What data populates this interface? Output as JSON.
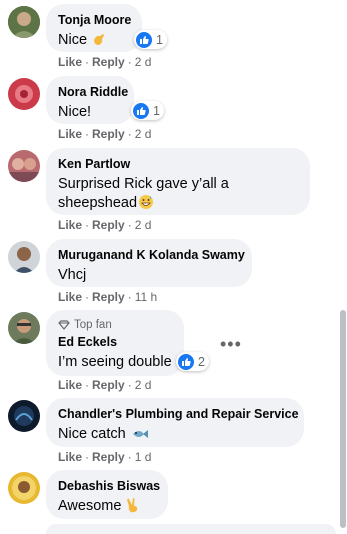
{
  "comments": [
    {
      "name": "Tonja Moore",
      "text": "Nice",
      "like": "Like",
      "reply": "Reply",
      "time": "2 d",
      "reaction_count": "1",
      "emoji": "hand-ok"
    },
    {
      "name": "Nora Riddle",
      "text": "Nice!",
      "like": "Like",
      "reply": "Reply",
      "time": "2 d",
      "reaction_count": "1"
    },
    {
      "name": "Ken Partlow",
      "text_line1": "Surprised Rick gave y’all a",
      "text_line2": "sheepshead",
      "like": "Like",
      "reply": "Reply",
      "time": "2 d",
      "emoji": "grinning-sweat"
    },
    {
      "name": "Muruganand K Kolanda Swamy",
      "text": "Vhcj",
      "like": "Like",
      "reply": "Reply",
      "time": "11 h"
    },
    {
      "name": "Ed Eckels",
      "badge": "Top fan",
      "text": "I’m seeing double",
      "like": "Like",
      "reply": "Reply",
      "time": "2 d",
      "reaction_count": "2"
    },
    {
      "name": "Chandler's Plumbing and Repair Service",
      "text": "Nice catch",
      "like": "Like",
      "reply": "Reply",
      "time": "1 d",
      "emoji": "fish"
    },
    {
      "name": "Debashis Biswas",
      "text": "Awesome",
      "like": "Like",
      "reply": "Reply",
      "time": "2 d",
      "emoji": "victory-hand"
    }
  ],
  "separator": "·",
  "colors": {
    "bubble": "#f0f2f5",
    "like_blue": "#1877f2",
    "meta_gray": "#65676b"
  }
}
